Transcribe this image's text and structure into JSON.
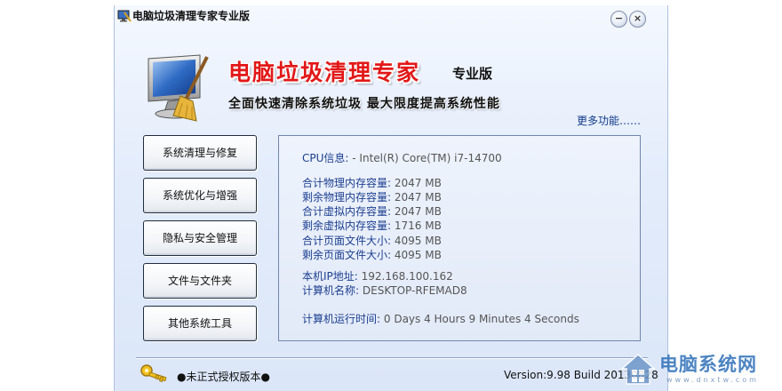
{
  "window": {
    "title": "电脑垃圾清理专家专业版",
    "minimize_glyph": "−",
    "close_glyph": "×"
  },
  "brand": {
    "name": "电脑垃圾清理专家",
    "edition": "专业版",
    "slogan": "全面快速清除系统垃圾  最大限度提高系统性能",
    "logo_icon": "monitor-broom-icon"
  },
  "more_link": "更多功能……",
  "menu": [
    {
      "label": "系统清理与修复"
    },
    {
      "label": "系统优化与增强"
    },
    {
      "label": "隐私与安全管理"
    },
    {
      "label": "文件与文件夹"
    },
    {
      "label": "其他系统工具"
    }
  ],
  "info": {
    "cpu": {
      "label": "CPU信息:",
      "value": "- Intel(R) Core(TM) i7-14700"
    },
    "total_physical": {
      "label": "合计物理内存容量:",
      "value": "2047 MB"
    },
    "free_physical": {
      "label": "剩余物理内存容量:",
      "value": "2047 MB"
    },
    "total_virtual": {
      "label": "合计虚拟内存容量:",
      "value": "2047 MB"
    },
    "free_virtual": {
      "label": "剩余虚拟内存容量:",
      "value": "1716 MB"
    },
    "total_pagefile": {
      "label": "合计页面文件大小:",
      "value": "4095 MB"
    },
    "free_pagefile": {
      "label": "剩余页面文件大小:",
      "value": "4095 MB"
    },
    "ip": {
      "label": "本机IP地址:",
      "value": "192.168.100.162"
    },
    "hostname": {
      "label": "计算机名称:",
      "value": "DESKTOP-RFEMAD8"
    },
    "uptime": {
      "label": "计算机运行时间:",
      "value": "0 Days 4 Hours 9 Minutes 4 Seconds"
    }
  },
  "footer": {
    "license": "●未正式授权版本●",
    "version": "Version:9.98 Build 20130828",
    "key_icon": "key-icon"
  },
  "watermark": {
    "text": "电脑系统网",
    "sub": "www.dnxtw.com"
  },
  "colors": {
    "brand_red": "#e21818",
    "label_blue": "#1c3f90",
    "value_gray": "#555555",
    "panel_border": "#6f86ad"
  }
}
